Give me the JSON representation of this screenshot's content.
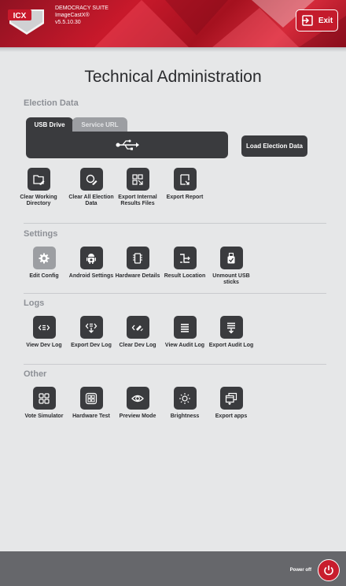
{
  "header": {
    "logo_text": "ICX",
    "suite": "DEMOCRACY SUITE",
    "product": "ImageCastX®",
    "version": "v5.5.10.30",
    "exit_label": "Exit"
  },
  "page_title": "Technical Administration",
  "sections": {
    "election_data": {
      "title": "Election Data",
      "tabs": [
        "USB Drive",
        "Service URL"
      ],
      "active_tab": "USB Drive",
      "usb_icon": "usb-icon",
      "load_label": "Load Election Data",
      "tools": [
        {
          "icon": "folder-eraser-icon",
          "label": "Clear Working Directory"
        },
        {
          "icon": "search-eraser-icon",
          "label": "Clear All Election Data"
        },
        {
          "icon": "export-grid-icon",
          "label": "Export Internal Results Files"
        },
        {
          "icon": "export-report-icon",
          "label": "Export Report"
        }
      ]
    },
    "settings": {
      "title": "Settings",
      "tools": [
        {
          "icon": "gear-icon",
          "label": "Edit Config"
        },
        {
          "icon": "android-icon",
          "label": "Android Settings"
        },
        {
          "icon": "chip-icon",
          "label": "Hardware Details"
        },
        {
          "icon": "result-location-icon",
          "label": "Result Location"
        },
        {
          "icon": "usb-stick-icon",
          "label": "Unmount USB sticks"
        }
      ]
    },
    "logs": {
      "title": "Logs",
      "tools": [
        {
          "icon": "log-view-icon",
          "label": "View Dev Log"
        },
        {
          "icon": "log-export-icon",
          "label": "Export Dev Log"
        },
        {
          "icon": "log-clear-icon",
          "label": "Clear Dev Log"
        },
        {
          "icon": "list-icon",
          "label": "View Audit Log"
        },
        {
          "icon": "list-export-icon",
          "label": "Export Audit Log"
        }
      ]
    },
    "other": {
      "title": "Other",
      "tools": [
        {
          "icon": "grid-icon",
          "label": "Vote Simulator"
        },
        {
          "icon": "hardware-grid-icon",
          "label": "Hardware Test"
        },
        {
          "icon": "eye-icon",
          "label": "Preview Mode"
        },
        {
          "icon": "sun-icon",
          "label": "Brightness"
        },
        {
          "icon": "windows-export-icon",
          "label": "Export apps"
        }
      ]
    }
  },
  "footer": {
    "power_label": "Power off"
  },
  "colors": {
    "brand_red": "#c8192b",
    "button_dark": "#3a3b3e",
    "button_disabled": "#9c9ea2",
    "background": "#e6e7e8",
    "footer": "#66676b"
  }
}
